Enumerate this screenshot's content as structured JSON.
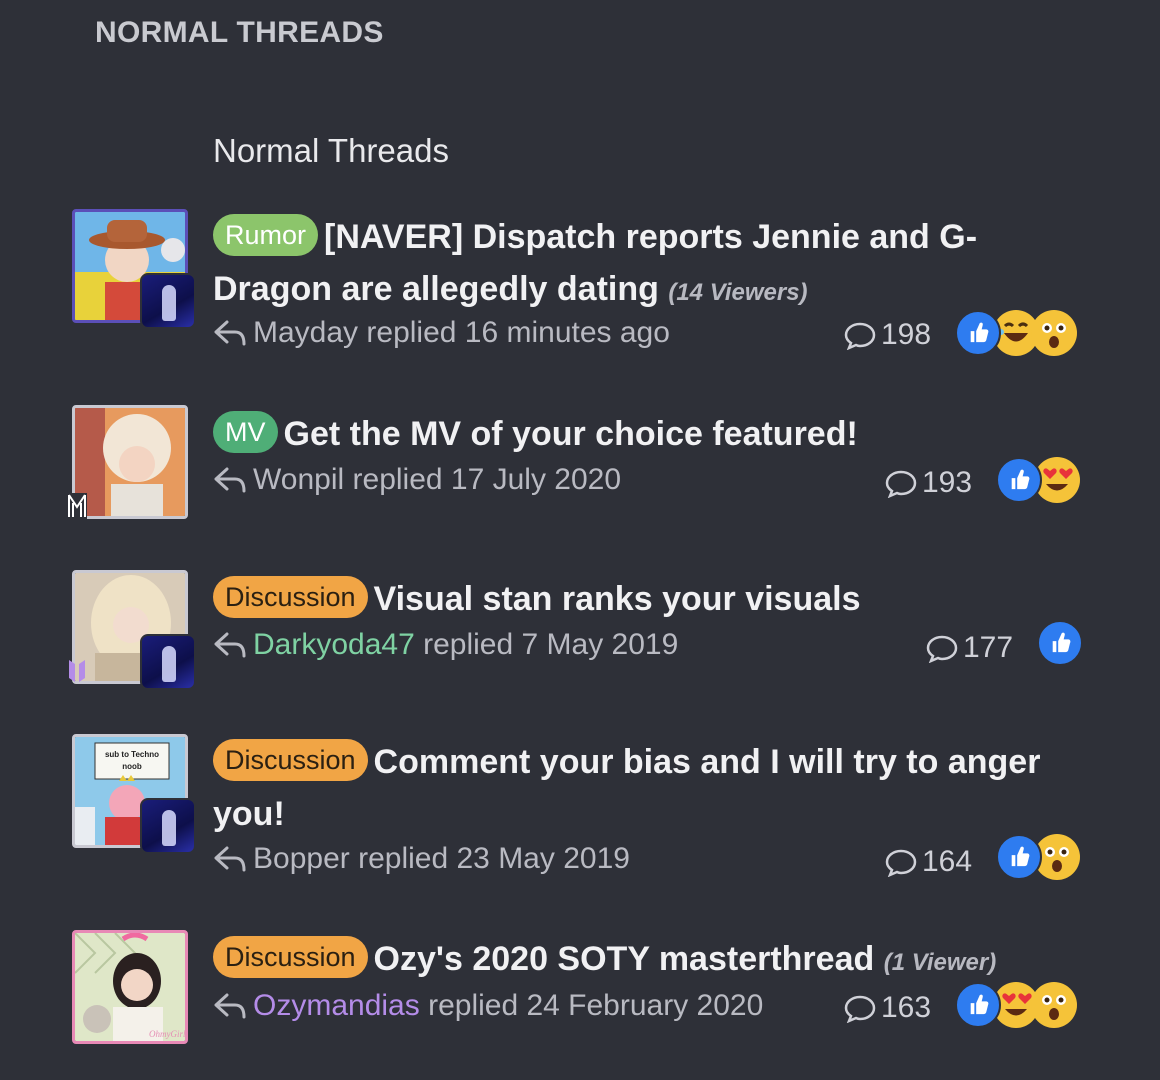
{
  "section_header": "NORMAL THREADS",
  "subheading": "Normal Threads",
  "threads": [
    {
      "prefix": "Rumor",
      "title": "[NAVER] Dispatch reports Jennie and G-Dragon are allegedly dating",
      "viewers": "(14 Viewers)",
      "user": "Mayday",
      "replied_text": "replied 16 minutes ago",
      "comment_count": "198",
      "reactions": [
        "like",
        "laugh",
        "wow"
      ]
    },
    {
      "prefix": "MV",
      "title": "Get the MV of your choice featured!",
      "viewers": "",
      "user": "Wonpil",
      "replied_text": "replied 17 July 2020",
      "comment_count": "193",
      "reactions": [
        "like",
        "love"
      ]
    },
    {
      "prefix": "Discussion",
      "title": "Visual stan ranks your visuals",
      "viewers": "",
      "user": "Darkyoda47",
      "replied_text": "replied 7 May 2019",
      "comment_count": "177",
      "reactions": [
        "like"
      ]
    },
    {
      "prefix": "Discussion",
      "title": "Comment your bias and I will try to anger you!",
      "viewers": "",
      "user": "Bopper",
      "replied_text": "replied 23 May 2019",
      "comment_count": "164",
      "reactions": [
        "like",
        "wow"
      ]
    },
    {
      "prefix": "Discussion",
      "title": "Ozy's 2020 SOTY masterthread",
      "viewers": "(1 Viewer)",
      "user": "Ozymandias",
      "replied_text": "replied 24 February 2020",
      "comment_count": "163",
      "reactions": [
        "like",
        "love",
        "wow"
      ]
    }
  ],
  "avatar_texts": {
    "sign": "sub to Techno noob",
    "logo": "OhmyGirl"
  },
  "colors": {
    "background": "#2e3038",
    "rumor": "#8cc56b",
    "mv": "#4fae77",
    "discussion": "#f1a545",
    "like": "#2e7cf0"
  }
}
